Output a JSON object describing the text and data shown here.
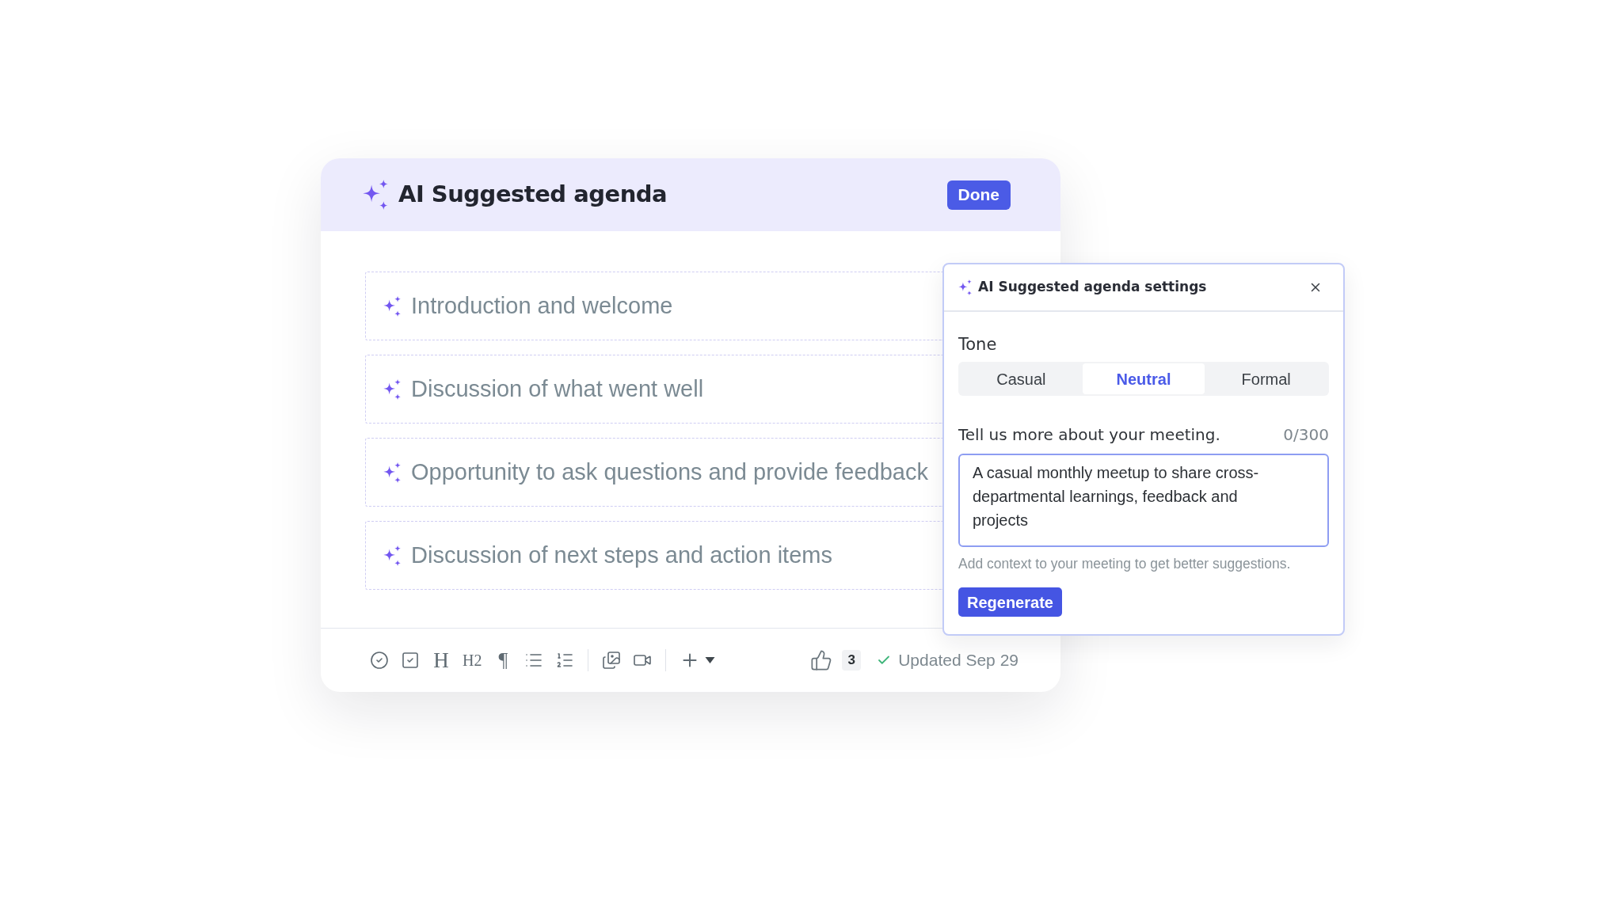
{
  "agenda_card": {
    "title": "AI Suggested agenda",
    "done_button": "Done",
    "items": [
      "Introduction and welcome",
      "Discussion of what went well",
      "Opportunity to ask questions and provide feedback",
      "Discussion of next steps and action items"
    ],
    "toolbar": {
      "format_glyphs": [
        "H",
        "H2",
        "¶"
      ],
      "likes": "3",
      "status": "Updated Sep 29"
    }
  },
  "settings_panel": {
    "title": "AI Suggested agenda settings",
    "tone": {
      "label": "Tone",
      "options": [
        {
          "label": "Casual",
          "selected": false
        },
        {
          "label": "Neutral",
          "selected": true
        },
        {
          "label": "Formal",
          "selected": false
        }
      ]
    },
    "description": {
      "label": "Tell us more about your meeting.",
      "counter": "0/300",
      "value": "A casual monthly meetup to share cross-departmental learnings, feedback and projects",
      "hint": "Add context to your meeting to get better suggestions."
    },
    "regenerate_button": "Regenerate"
  }
}
